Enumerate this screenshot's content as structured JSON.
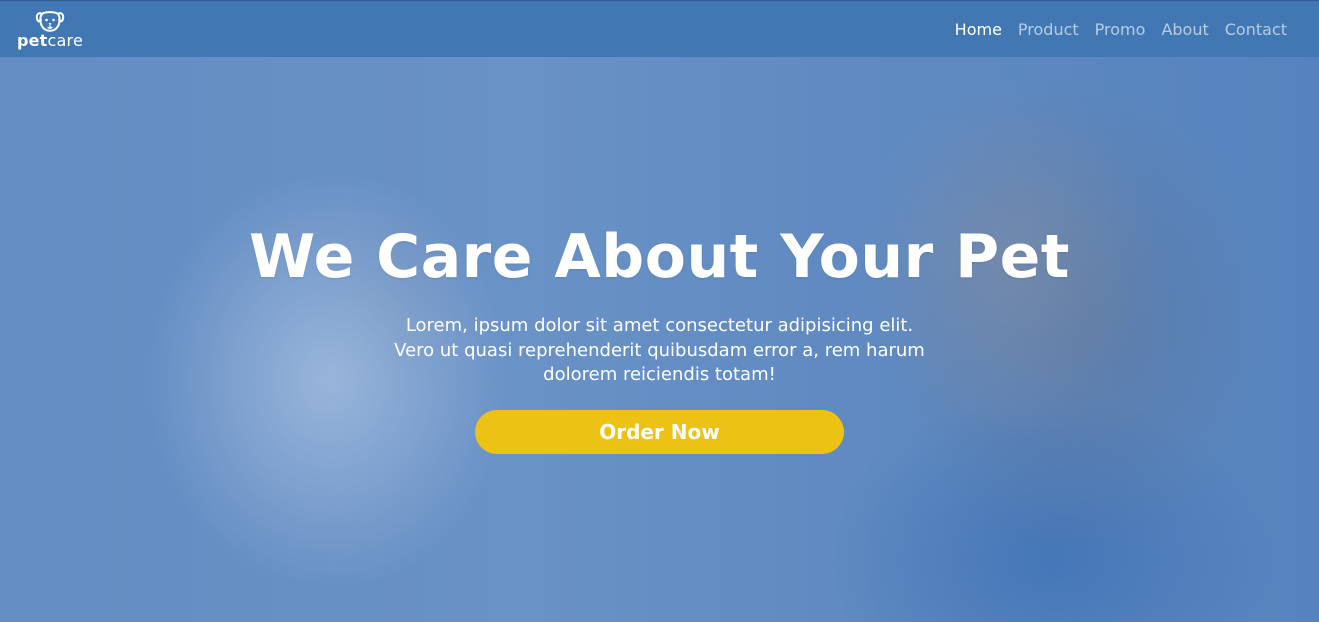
{
  "brand": {
    "logo_bold": "pet",
    "logo_light": "care",
    "icon": "dog-face-icon"
  },
  "nav": {
    "items": [
      {
        "label": "Home",
        "active": true
      },
      {
        "label": "Product",
        "active": false
      },
      {
        "label": "Promo",
        "active": false
      },
      {
        "label": "About",
        "active": false
      },
      {
        "label": "Contact",
        "active": false
      }
    ]
  },
  "hero": {
    "title": "We Care About Your Pet",
    "text": "Lorem, ipsum dolor sit amet consectetur adipisicing elit. Vero ut quasi reprehenderit quibusdam error a, rem harum dolorem reiciendis totam!",
    "cta_label": "Order Now"
  },
  "colors": {
    "navbar": "#4178b4",
    "overlay": "#497bbe",
    "cta": "#ecc215",
    "text": "#ffffff"
  }
}
